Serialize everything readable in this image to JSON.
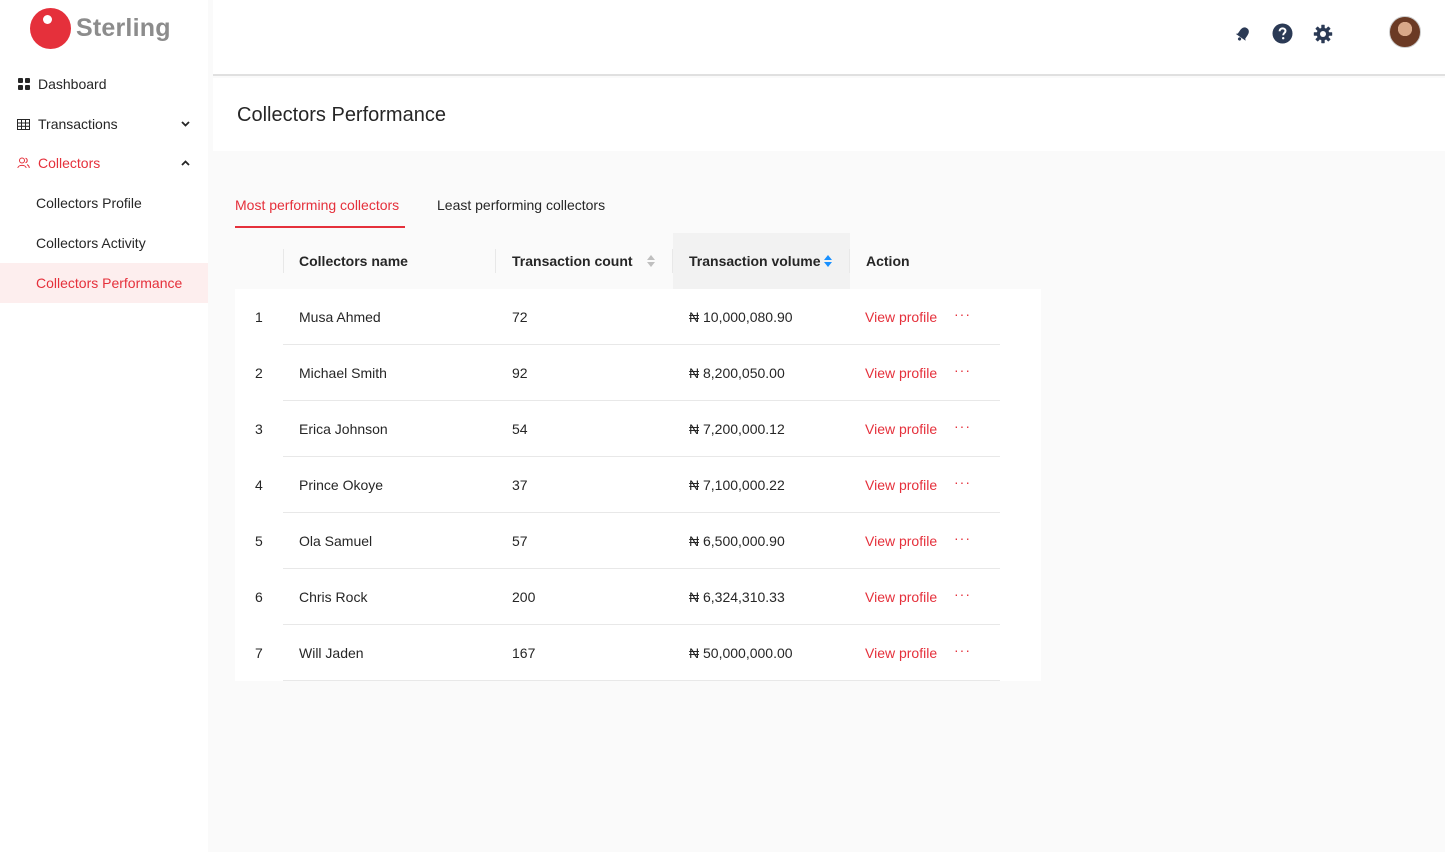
{
  "brand": {
    "name": "Sterling",
    "accent": "#e5303b"
  },
  "sidebar": {
    "items": [
      {
        "label": "Dashboard",
        "icon": "dashboard-icon"
      },
      {
        "label": "Transactions",
        "icon": "table-icon"
      },
      {
        "label": "Collectors",
        "icon": "users-icon"
      }
    ],
    "sub_items": [
      {
        "label": "Collectors Profile"
      },
      {
        "label": "Collectors Activity"
      },
      {
        "label": "Collectors Performance"
      }
    ]
  },
  "header": {
    "icons": [
      "notification-icon",
      "help-icon",
      "settings-icon"
    ],
    "avatar": "user-avatar"
  },
  "page": {
    "title": "Collectors Performance"
  },
  "tabs": [
    {
      "label": "Most performing collectors",
      "active": true
    },
    {
      "label": "Least performing collectors",
      "active": false
    }
  ],
  "table": {
    "columns": [
      "Collectors name",
      "Transaction count",
      "Transaction volume",
      "Action"
    ],
    "sorted_column": "Transaction volume",
    "rows": [
      {
        "index": "1",
        "name": "Musa Ahmed",
        "count": "72",
        "volume": "₦ 10,000,080.90",
        "action": "View profile",
        "more": "···"
      },
      {
        "index": "2",
        "name": "Michael Smith",
        "count": "92",
        "volume": "₦ 8,200,050.00",
        "action": "View profile",
        "more": "···"
      },
      {
        "index": "3",
        "name": "Erica Johnson",
        "count": "54",
        "volume": "₦ 7,200,000.12",
        "action": "View profile",
        "more": "···"
      },
      {
        "index": "4",
        "name": "Prince Okoye",
        "count": "37",
        "volume": "₦ 7,100,000.22",
        "action": "View profile",
        "more": "···"
      },
      {
        "index": "5",
        "name": "Ola Samuel",
        "count": "57",
        "volume": "₦ 6,500,000.90",
        "action": "View profile",
        "more": "···"
      },
      {
        "index": "6",
        "name": "Chris Rock",
        "count": "200",
        "volume": "₦ 6,324,310.33",
        "action": "View profile",
        "more": "···"
      },
      {
        "index": "7",
        "name": "Will Jaden",
        "count": "167",
        "volume": "₦ 50,000,000.00",
        "action": "View profile",
        "more": "···"
      }
    ]
  }
}
